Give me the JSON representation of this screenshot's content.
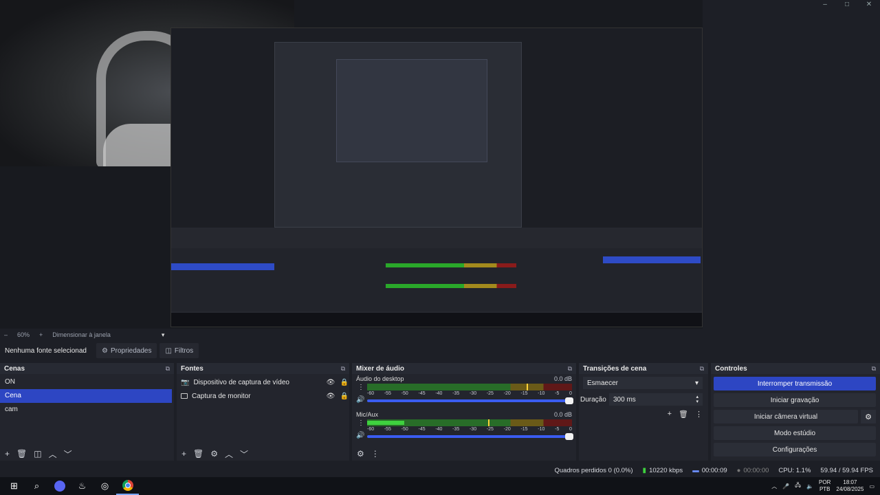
{
  "window": {
    "controls": [
      "–",
      "□",
      "✕"
    ]
  },
  "zoom": {
    "minus": "–",
    "value": "60%",
    "plus": "+",
    "fit": "Dimensionar à janela",
    "caret": "▾"
  },
  "propsbar": {
    "no_source": "Nenhuma fonte selecionad",
    "properties": "Propriedades",
    "filters": "Filtros"
  },
  "scenes": {
    "title": "Cenas",
    "items": [
      {
        "label": "ON"
      },
      {
        "label": "Cena",
        "selected": true
      },
      {
        "label": "cam"
      }
    ]
  },
  "sources": {
    "title": "Fontes",
    "items": [
      {
        "label": "Dispositivo de captura de vídeo",
        "icon": "camera-icon"
      },
      {
        "label": "Captura de monitor",
        "icon": "monitor-icon"
      }
    ]
  },
  "mixer": {
    "title": "Mixer de áudio",
    "ticks": [
      "-60",
      "-55",
      "-50",
      "-45",
      "-40",
      "-35",
      "-30",
      "-25",
      "-20",
      "-15",
      "-10",
      "-5",
      "0"
    ],
    "channels": [
      {
        "name": "Áudio do desktop",
        "db": "0.0 dB",
        "level": 0.0,
        "peak": 0.78,
        "volume": 1.0
      },
      {
        "name": "Mic/Aux",
        "db": "0.0 dB",
        "level": 0.18,
        "peak": 0.59,
        "volume": 1.0
      }
    ]
  },
  "transitions": {
    "title": "Transições de cena",
    "selected": "Esmaecer",
    "duration_label": "Duração",
    "duration_value": "300 ms"
  },
  "controls": {
    "title": "Controles",
    "stop_stream": "Interromper transmissão",
    "start_record": "Iniciar gravação",
    "virtual_cam": "Iniciar câmera virtual",
    "studio_mode": "Modo estúdio",
    "settings": "Configurações"
  },
  "status": {
    "dropped": "Quadros perdidos 0 (0.0%)",
    "bitrate": "10220 kbps",
    "stream_time": "00:00:09",
    "rec_time": "00:00:00",
    "cpu": "CPU: 1.1%",
    "fps": "59.94 / 59.94 FPS"
  },
  "taskbar": {
    "lang_top": "POR",
    "lang_bottom": "PTB",
    "time": "18:07",
    "date": "24/08/2025"
  },
  "colors": {
    "accent": "#2d46c3",
    "meter_green": "#3fd13f",
    "meter_yellow": "#a38a1d",
    "meter_red": "#8a1b1b"
  }
}
